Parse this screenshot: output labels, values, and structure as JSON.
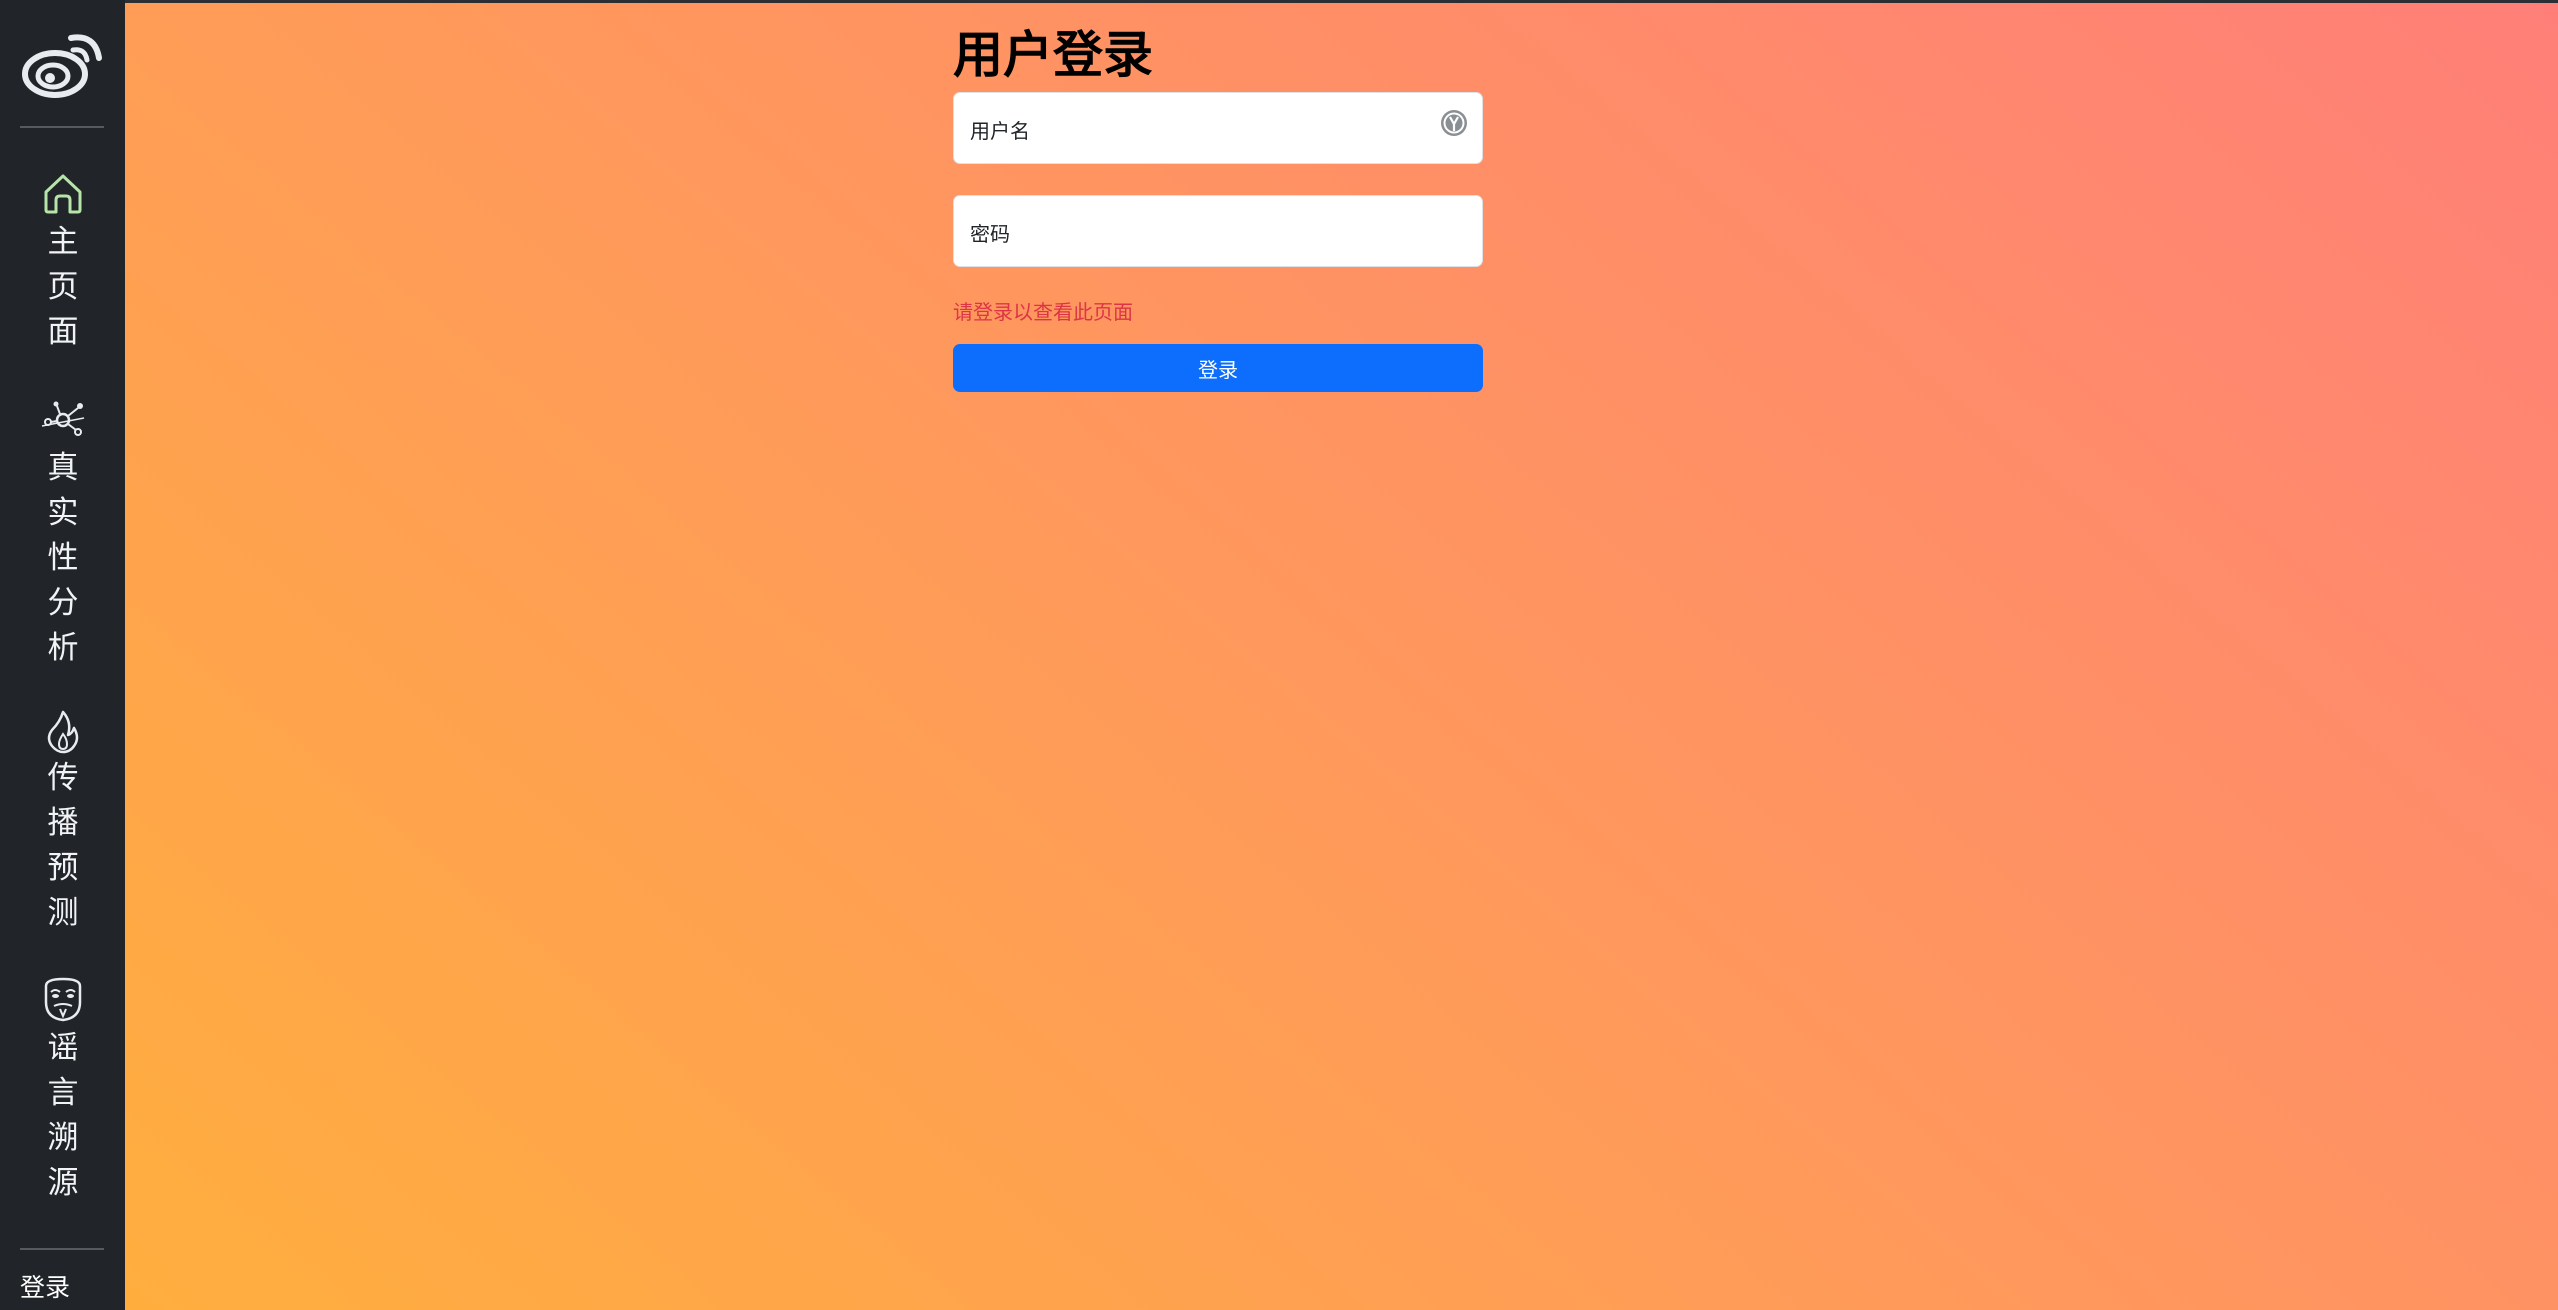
{
  "sidebar": {
    "logo_icon": "weibo-logo-icon",
    "items": [
      {
        "icon": "home-icon",
        "label": "主页面"
      },
      {
        "icon": "network-graph-icon",
        "label": "真实性分析"
      },
      {
        "icon": "flame-icon",
        "label": "传播预测"
      },
      {
        "icon": "mask-icon",
        "label": "谣言溯源"
      }
    ],
    "login_link": "登录"
  },
  "login_form": {
    "title": "用户登录",
    "username_label": "用户名",
    "username_icon": "password-manager-icon",
    "password_label": "密码",
    "error_message": "请登录以查看此页面",
    "submit_label": "登录"
  },
  "colors": {
    "sidebar_bg": "#212529",
    "gradient_start": "#ffae3e",
    "gradient_end": "#ff7f78",
    "primary_button": "#0d6efd",
    "error_text": "#dc3545"
  }
}
